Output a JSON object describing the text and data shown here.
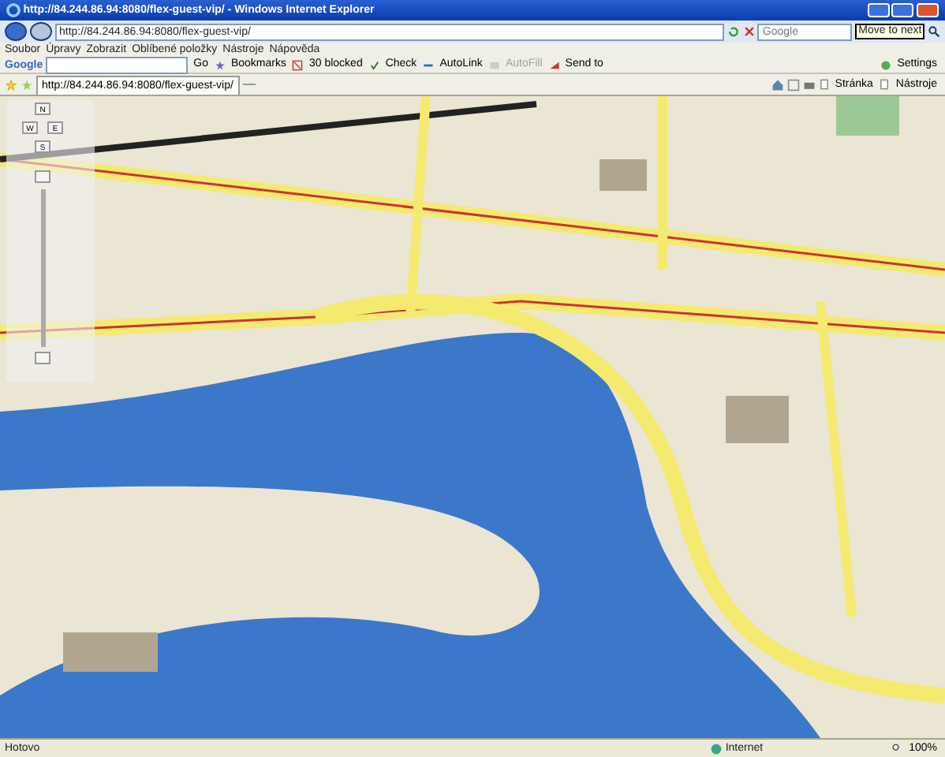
{
  "window": {
    "title": "http://84.244.86.94:8080/flex-guest-vip/ - Windows Internet Explorer"
  },
  "address_bar": {
    "value": "http://84.244.86.94:8080/flex-guest-vip/"
  },
  "search": {
    "placeholder": "Google",
    "tooltip": "Move to next"
  },
  "menu": [
    "Soubor",
    "Úpravy",
    "Zobrazit",
    "Oblíbené položky",
    "Nástroje",
    "Nápověda"
  ],
  "google_toolbar": {
    "logo": "Google",
    "items": [
      {
        "label": "Go",
        "disabled": false
      },
      {
        "label": "Bookmarks",
        "disabled": false
      },
      {
        "label": "30 blocked",
        "disabled": false
      },
      {
        "label": "Check",
        "disabled": false
      },
      {
        "label": "AutoLink",
        "disabled": false
      },
      {
        "label": "AutoFill",
        "disabled": true
      },
      {
        "label": "Send to",
        "disabled": false
      }
    ],
    "settings": "Settings"
  },
  "tabs": [
    {
      "label": "http://84.244.86.94:8080/flex-guest-vip/",
      "selected": true
    }
  ],
  "command_bar": [
    "Stránka",
    "Nástroje"
  ],
  "map_controls": {
    "directions": [
      "N",
      "W",
      "E",
      "S"
    ]
  },
  "status_bar": {
    "text": "Hotovo",
    "zone": "Internet",
    "zoom": "100%"
  }
}
